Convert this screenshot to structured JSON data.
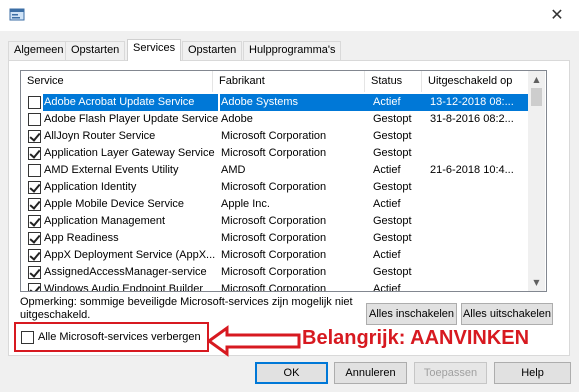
{
  "window": {
    "close_glyph": "✕",
    "icon": "msconfig-icon"
  },
  "tabs": [
    {
      "label": "Algemeen"
    },
    {
      "label": "Opstarten"
    },
    {
      "label": "Services"
    },
    {
      "label": "Opstarten"
    },
    {
      "label": "Hulpprogramma's"
    }
  ],
  "columns": {
    "service": "Service",
    "vendor": "Fabrikant",
    "status": "Status",
    "disabled": "Uitgeschakeld op"
  },
  "rows": [
    {
      "checked": false,
      "selected": true,
      "name": "Adobe Acrobat Update Service",
      "vendor": "Adobe Systems",
      "status": "Actief",
      "date": "13-12-2018 08:..."
    },
    {
      "checked": false,
      "selected": false,
      "name": "Adobe Flash Player Update Service",
      "vendor": "Adobe",
      "status": "Gestopt",
      "date": "31-8-2016 08:2..."
    },
    {
      "checked": true,
      "selected": false,
      "name": "AllJoyn Router Service",
      "vendor": "Microsoft Corporation",
      "status": "Gestopt",
      "date": ""
    },
    {
      "checked": true,
      "selected": false,
      "name": "Application Layer Gateway Service",
      "vendor": "Microsoft Corporation",
      "status": "Gestopt",
      "date": ""
    },
    {
      "checked": false,
      "selected": false,
      "name": "AMD External Events Utility",
      "vendor": "AMD",
      "status": "Actief",
      "date": "21-6-2018 10:4..."
    },
    {
      "checked": true,
      "selected": false,
      "name": "Application Identity",
      "vendor": "Microsoft Corporation",
      "status": "Gestopt",
      "date": ""
    },
    {
      "checked": true,
      "selected": false,
      "name": "Apple Mobile Device Service",
      "vendor": "Apple Inc.",
      "status": "Actief",
      "date": ""
    },
    {
      "checked": true,
      "selected": false,
      "name": "Application Management",
      "vendor": "Microsoft Corporation",
      "status": "Gestopt",
      "date": ""
    },
    {
      "checked": true,
      "selected": false,
      "name": "App Readiness",
      "vendor": "Microsoft Corporation",
      "status": "Gestopt",
      "date": ""
    },
    {
      "checked": true,
      "selected": false,
      "name": "AppX Deployment Service (AppX...",
      "vendor": "Microsoft Corporation",
      "status": "Actief",
      "date": ""
    },
    {
      "checked": true,
      "selected": false,
      "name": "AssignedAccessManager-service",
      "vendor": "Microsoft Corporation",
      "status": "Gestopt",
      "date": ""
    },
    {
      "checked": true,
      "selected": false,
      "name": "Windows Audio Endpoint Builder",
      "vendor": "Microsoft Corporation",
      "status": "Actief",
      "date": ""
    }
  ],
  "note": "Opmerking: sommige beveiligde Microsoft-services zijn mogelijk niet uitgeschakeld.",
  "buttons": {
    "enable_all": "Alles inschakelen",
    "disable_all": "Alles uitschakelen",
    "ok": "OK",
    "cancel": "Annuleren",
    "apply": "Toepassen",
    "help": "Help"
  },
  "hide_ms": {
    "label": "Alle Microsoft-services verbergen",
    "checked": false
  },
  "annotation": {
    "text": "Belangrijk: AANVINKEN",
    "color": "#d71920"
  },
  "colors": {
    "selection": "#0078d7",
    "accent": "#0078d7"
  }
}
